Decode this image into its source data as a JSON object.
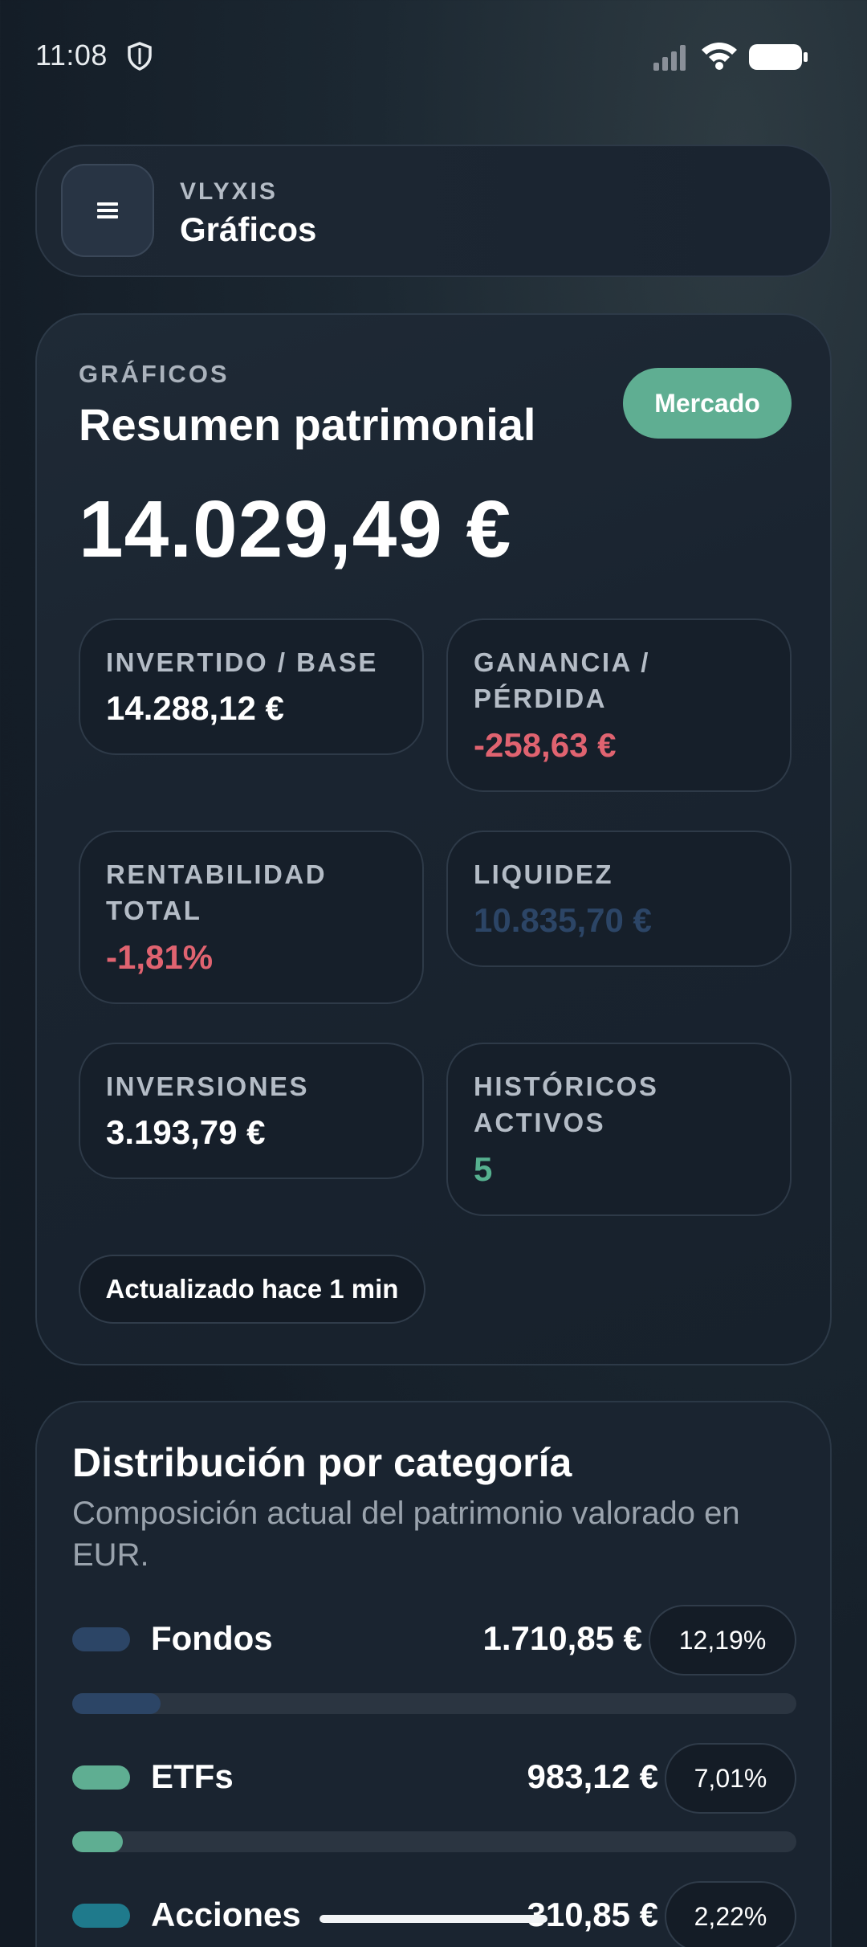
{
  "status_bar": {
    "time": "11:08",
    "icons": [
      "shield-icon",
      "signal-icon",
      "wifi-icon",
      "battery-icon"
    ]
  },
  "header": {
    "menu_icon": "hamburger-icon",
    "app_name": "VLYXIS",
    "title": "Gráficos"
  },
  "summary": {
    "eyebrow": "GRÁFICOS",
    "title": "Resumen patrimonial",
    "market_button": "Mercado",
    "total": "14.029,49 €",
    "metrics": [
      {
        "label": "INVERTIDO / BASE",
        "value": "14.288,12 €",
        "tone": "neutral"
      },
      {
        "label": "GANANCIA / PÉRDIDA",
        "value": "-258,63 €",
        "tone": "negative"
      },
      {
        "label": "RENTABILIDAD TOTAL",
        "value": "-1,81%",
        "tone": "negative"
      },
      {
        "label": "LIQUIDEZ",
        "value": "10.835,70 €",
        "tone": "muted-blue"
      },
      {
        "label": "INVERSIONES",
        "value": "3.193,79 €",
        "tone": "neutral"
      },
      {
        "label": "HISTÓRICOS ACTIVOS",
        "value": "5",
        "tone": "positive"
      }
    ],
    "updated": "Actualizado hace 1 min"
  },
  "distribution": {
    "title": "Distribución por categoría",
    "subtitle": "Composición actual del patrimonio valorado en EUR.",
    "categories": [
      {
        "name": "Fondos",
        "amount": "1.710,85 €",
        "percent": "12,19%",
        "share": 0.1219,
        "color": "#2c4566"
      },
      {
        "name": "ETFs",
        "amount": "983,12 €",
        "percent": "7,01%",
        "share": 0.0701,
        "color": "#5fae92"
      },
      {
        "name": "Acciones",
        "amount": "310,85 €",
        "percent": "2,22%",
        "share": 0.0222,
        "color": "#1f7a8c"
      }
    ]
  },
  "colors": {
    "accent_green": "#5fae92",
    "negative_red": "#e06370",
    "muted_blue": "#2c4566",
    "background": "#141d27"
  }
}
